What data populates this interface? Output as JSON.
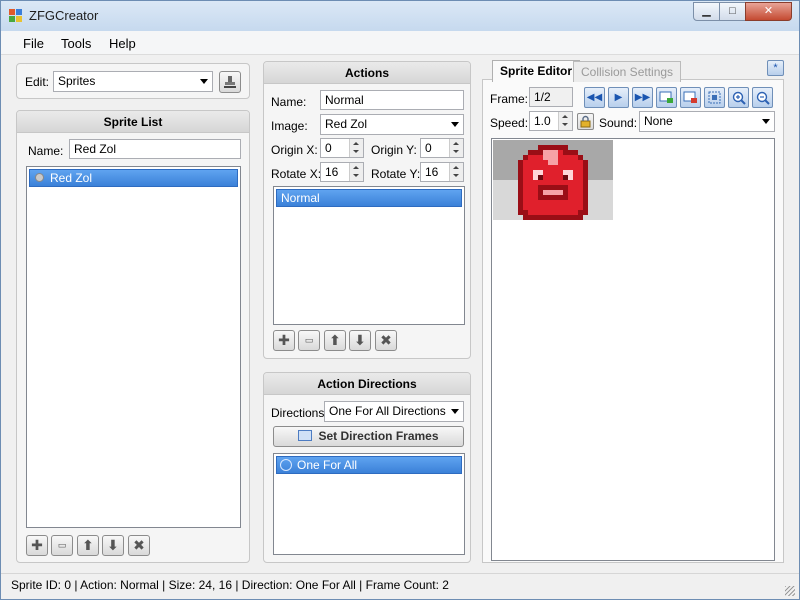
{
  "window": {
    "title": "ZFGCreator"
  },
  "menu": [
    "File",
    "Tools",
    "Help"
  ],
  "edit": {
    "label": "Edit:",
    "value": "Sprites"
  },
  "sprite_list": {
    "header": "Sprite List",
    "name_label": "Name:",
    "name_value": "Red Zol",
    "items": [
      "Red Zol"
    ]
  },
  "actions": {
    "header": "Actions",
    "name_label": "Name:",
    "name_value": "Normal",
    "image_label": "Image:",
    "image_value": "Red Zol",
    "origin_x_label": "Origin X:",
    "origin_x_value": "0",
    "origin_y_label": "Origin Y:",
    "origin_y_value": "0",
    "rotate_x_label": "Rotate X:",
    "rotate_x_value": "16",
    "rotate_y_label": "Rotate Y:",
    "rotate_y_value": "16",
    "items": [
      "Normal"
    ]
  },
  "directions": {
    "header": "Action Directions",
    "label": "Directions:",
    "value": "One For All Directions",
    "set_frames_button": "Set Direction Frames",
    "items": [
      "One For All"
    ]
  },
  "sprite_editor": {
    "tabs": [
      "Sprite Editor",
      "Collision Settings"
    ],
    "active_tab": "Sprite Editor",
    "pin_label": "*",
    "frame_label": "Frame:",
    "frame_value": "1/2",
    "speed_label": "Speed:",
    "speed_value": "1.0",
    "sound_label": "Sound:",
    "sound_value": "None"
  },
  "status": "Sprite ID: 0 | Action: Normal | Size: 24, 16 | Direction: One For All | Frame Count: 2",
  "colors": {
    "selection": "#3b81d8",
    "sprite_red": "#e0202c",
    "sprite_dark": "#9a0e16",
    "sprite_light": "#f6a2a6",
    "sprite_bg_grey": "#a8a8a8",
    "sprite_bg_light": "#d8d8d8"
  }
}
